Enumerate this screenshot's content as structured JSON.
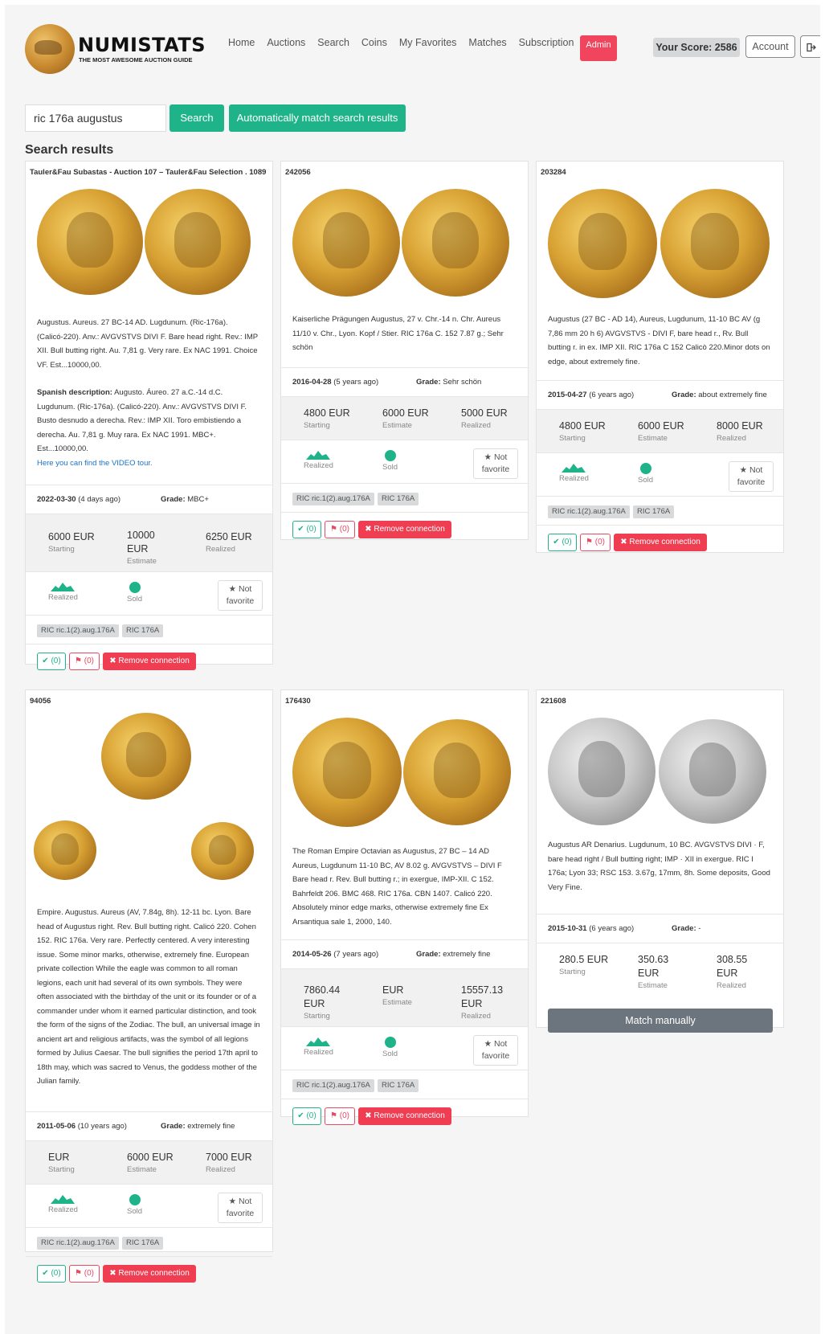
{
  "header": {
    "brand": "NUMISTATS",
    "tagline": "THE MOST AWESOME AUCTION GUIDE",
    "nav": [
      "Home",
      "Auctions",
      "Search",
      "Coins",
      "My Favorites",
      "Matches",
      "Subscription"
    ],
    "admin_label": "Admin",
    "score_label": "Your Score: 2586",
    "account_label": "Account",
    "logout_icon": "sign-out-icon"
  },
  "search": {
    "query": "ric 176a augustus",
    "search_button": "Search",
    "auto_match_button": "Automatically match search results"
  },
  "results_title": "Search results",
  "labels": {
    "starting": "Starting",
    "estimate": "Estimate",
    "realized": "Realized",
    "sold": "Sold",
    "not_favorite": "Not favorite",
    "grade": "Grade:",
    "ok_count": "(0)",
    "flag_count": "(0)",
    "remove_connection": "Remove connection",
    "match_manually": "Match manually"
  },
  "colors": {
    "accent": "#1fb38a",
    "danger": "#ef3d52",
    "admin": "#f0455c"
  },
  "cards": [
    {
      "title": "Tauler&Fau Subastas - Auction 107 – Tauler&Fau Selection . 1089",
      "description": "Augustus. Aureus. 27 BC-14 AD. Lugdunum. (Ric-176a). (Calicó-220). Anv.: AVGVSTVS DIVI F. Bare head right. Rev.: IMP XII. Bull butting right. Au. 7,81 g. Very rare. Ex NAC 1991. Choice VF. Est...10000,00.",
      "spanish_label": "Spanish description:",
      "spanish": "Augusto. Áureo. 27 a.C.-14 d.C. Lugdunum. (Ric-176a). (Calicó-220). Anv.: AVGVSTVS DIVI F. Busto desnudo a derecha. Rev.: IMP XII. Toro embistiendo a derecha. Au. 7,81 g. Muy rara. Ex NAC 1991. MBC+. Est...10000,00.",
      "video_link": "Here you can find the VIDEO tour.",
      "date": "2022-03-30",
      "ago": "(4 days ago)",
      "grade": "MBC+",
      "starting": "6000 EUR",
      "estimate": "10000 EUR",
      "realized": "6250 EUR",
      "tags": [
        "RIC ric.1(2).aug.176A",
        "RIC 176A"
      ]
    },
    {
      "title": "242056",
      "description": "Kaiserliche Prägungen Augustus, 27 v. Chr.-14 n. Chr. Aureus 11/10 v. Chr., Lyon. Kopf / Stier. RIC 176a C. 152 7.87 g.; Sehr schön",
      "date": "2016-04-28",
      "ago": "(5 years ago)",
      "grade": "Sehr schön",
      "starting": "4800 EUR",
      "estimate": "6000 EUR",
      "realized": "5000 EUR",
      "tags": [
        "RIC ric.1(2).aug.176A",
        "RIC 176A"
      ]
    },
    {
      "title": "203284",
      "description": "Augustus (27 BC - AD 14), Aureus, Lugdunum, 11-10 BC AV (g 7,86 mm 20 h 6) AVGVSTVS - DIVI F, bare head r., Rv. Bull butting r. in ex. IMP XII. RIC 176a C 152 Calicò 220.Minor dots on edge, about extremely fine.",
      "date": "2015-04-27",
      "ago": "(6 years ago)",
      "grade": "about extremely fine",
      "starting": "4800 EUR",
      "estimate": "6000 EUR",
      "realized": "8000 EUR",
      "tags": [
        "RIC ric.1(2).aug.176A",
        "RIC 176A"
      ]
    },
    {
      "title": "94056",
      "description": "Empire. Augustus. Aureus (AV, 7.84g, 8h). 12-11 bc. Lyon. Bare head of Augustus right. Rev. Bull butting right. Calicó 220. Cohen 152. RIC 176a. Very rare. Perfectly centered. A very interesting issue. Some minor marks, otherwise, extremely fine. European private collection While the eagle was common to all roman legions, each unit had several of its own symbols. They were often associated with the birthday of the unit or its founder or of a commander under whom it earned particular distinction, and took the form of the signs of the Zodiac. The bull, an universal image in ancient art and religious artifacts, was the symbol of all legions formed by Julius Caesar. The bull signifies the period 17th april to 18th may, which was sacred to Venus, the goddess mother of the Julian family.",
      "date": "2011-05-06",
      "ago": "(10 years ago)",
      "grade": "extremely fine",
      "starting": "EUR",
      "estimate": "6000 EUR",
      "realized": "7000 EUR",
      "tags": [
        "RIC ric.1(2).aug.176A",
        "RIC 176A"
      ]
    },
    {
      "title": "176430",
      "description": "The Roman Empire Octavian as Augustus, 27 BC – 14 AD Aureus, Lugdunum 11-10 BC, AV 8.02 g. AVGVSTVS – DIVI F Bare head r. Rev. Bull butting r.; in exergue, IMP-XII. C 152. Bahrfeldt 206. BMC 468. RIC 176a. CBN 1407. Calicó 220. Absolutely minor edge marks, otherwise extremely fine Ex Arsantiqua sale 1, 2000, 140.",
      "date": "2014-05-26",
      "ago": "(7 years ago)",
      "grade": "extremely fine",
      "starting": "7860.44 EUR",
      "estimate": "EUR",
      "realized": "15557.13 EUR",
      "tags": [
        "RIC ric.1(2).aug.176A",
        "RIC 176A"
      ]
    },
    {
      "title": "221608",
      "description": "Augustus AR Denarius. Lugdunum, 10 BC. AVGVSTVS DIVI · F, bare head right / Bull butting right; IMP · XII in exergue. RIC I 176a; Lyon 33; RSC 153. 3.67g, 17mm, 8h. Some deposits, Good Very Fine.",
      "date": "2015-10-31",
      "ago": "(6 years ago)",
      "grade": "-",
      "starting": "280.5 EUR",
      "estimate": "350.63 EUR",
      "realized": "308.55 EUR"
    }
  ]
}
